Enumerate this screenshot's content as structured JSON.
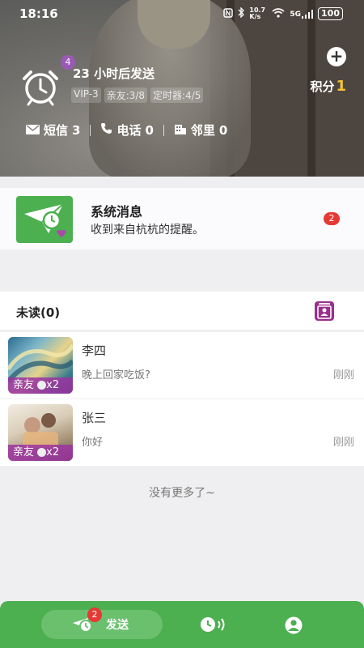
{
  "status_bar": {
    "time": "18:16",
    "icons": [
      "nfc-icon",
      "bluetooth-icon",
      "speed-icon",
      "wifi-icon",
      "5g-signal-icon"
    ],
    "speed": "10.7 K/s",
    "network": "5G",
    "battery": "100"
  },
  "header": {
    "alarm_badge": "4",
    "send_time": "23 小时后发送",
    "tags": [
      "VIP-3",
      "亲友:3/8",
      "定时器:4/5"
    ],
    "points_label": "积分",
    "points_value": "1",
    "counters": [
      {
        "label": "短信",
        "value": "3"
      },
      {
        "label": "电话",
        "value": "0"
      },
      {
        "label": "邻里",
        "value": "0"
      }
    ]
  },
  "system_message": {
    "title": "系统消息",
    "subtitle": "收到来自杭杭的提醒。",
    "badge": "2"
  },
  "unread": {
    "title": "未读(0)"
  },
  "messages": [
    {
      "name": "李四",
      "preview": "晚上回家吃饭?",
      "time": "刚刚",
      "tag": "亲友",
      "multiplier": "x2"
    },
    {
      "name": "张三",
      "preview": "你好",
      "time": "刚刚",
      "tag": "亲友",
      "multiplier": "x2"
    }
  ],
  "no_more": "没有更多了~",
  "bottom_nav": {
    "send_label": "发送",
    "send_badge": "2",
    "accent": "#4caf50"
  }
}
